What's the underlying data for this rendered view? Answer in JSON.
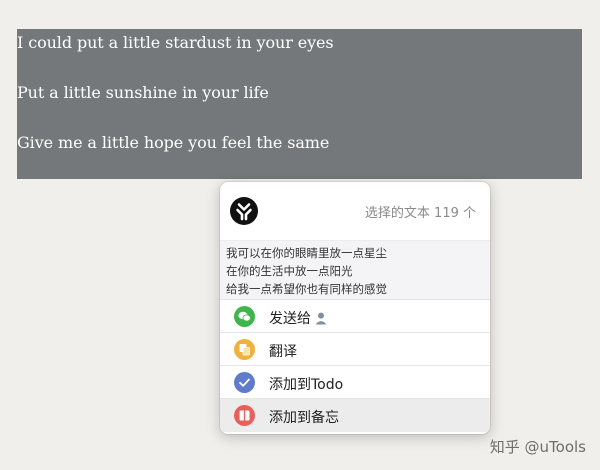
{
  "document": {
    "selected_lines": [
      "I could put a little stardust in your eyes",
      "Put a little sunshine in your life",
      "Give me a little hope you feel the same"
    ]
  },
  "popup": {
    "selection_count_label": "选择的文本 119 个",
    "preview_lines": [
      "我可以在你的眼睛里放一点星尘",
      "在你的生活中放一点阳光",
      "给我一点希望你也有同样的感觉"
    ],
    "menu": [
      {
        "label": "发送给",
        "icon": "wechat-icon",
        "color": "#3fb54b"
      },
      {
        "label": "翻译",
        "icon": "translate-icon",
        "color": "#f0b13f"
      },
      {
        "label": "添加到Todo",
        "icon": "check-icon",
        "color": "#5f7bc9"
      },
      {
        "label": "添加到备忘",
        "icon": "memo-icon",
        "color": "#e9605b"
      }
    ],
    "active_item_index": 3
  },
  "watermark": "知乎 @uTools",
  "colors": {
    "selection_background": "#75787b",
    "page_background": "#f0efeb"
  }
}
